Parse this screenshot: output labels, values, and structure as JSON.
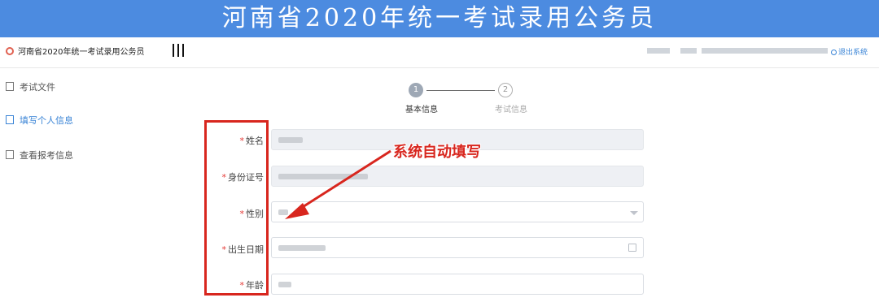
{
  "banner": {
    "title": "河南省2020年统一考试录用公务员"
  },
  "topbar": {
    "system_name": "河南省2020年统一考试录用公务员",
    "logout_label": "退出系统"
  },
  "sidebar": {
    "items": [
      {
        "label": "考试文件",
        "icon": "document-icon",
        "active": false
      },
      {
        "label": "填写个人信息",
        "icon": "form-icon",
        "active": true
      },
      {
        "label": "查看报考信息",
        "icon": "profile-icon",
        "active": false
      }
    ]
  },
  "steps": [
    {
      "number": "1",
      "label": "基本信息",
      "state": "current"
    },
    {
      "number": "2",
      "label": "考试信息",
      "state": "pending"
    }
  ],
  "form": {
    "required_mark": "*",
    "fields": [
      {
        "label": "姓名",
        "type": "readonly"
      },
      {
        "label": "身份证号",
        "type": "readonly"
      },
      {
        "label": "性别",
        "type": "select"
      },
      {
        "label": "出生日期",
        "type": "date"
      },
      {
        "label": "年龄",
        "type": "text"
      }
    ]
  },
  "annotation": {
    "callout_text": "系统自动填写",
    "color": "#d8261e"
  },
  "colors": {
    "banner": "#4c8be0",
    "accent": "#3a84d6",
    "required": "#e53935"
  }
}
